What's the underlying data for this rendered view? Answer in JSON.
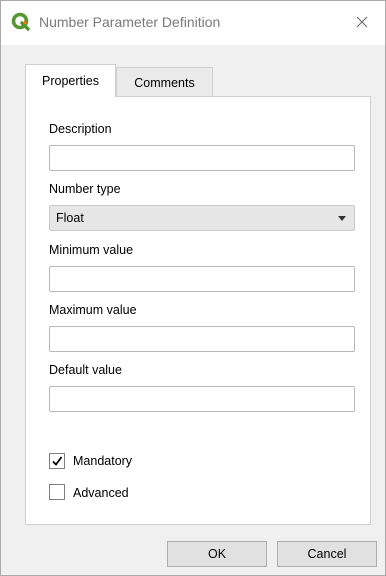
{
  "window": {
    "title": "Number Parameter Definition",
    "app_icon": "qgis-logo-icon",
    "close_icon": "close-icon"
  },
  "tabs": [
    {
      "label": "Properties",
      "active": true
    },
    {
      "label": "Comments",
      "active": false
    }
  ],
  "form": {
    "description_label": "Description",
    "description_value": "",
    "number_type_label": "Number type",
    "number_type_value": "Float",
    "minimum_label": "Minimum value",
    "minimum_value": "",
    "maximum_label": "Maximum value",
    "maximum_value": "",
    "default_label": "Default value",
    "default_value": "",
    "mandatory_label": "Mandatory",
    "mandatory_checked": true,
    "advanced_label": "Advanced",
    "advanced_checked": false
  },
  "buttons": {
    "ok_label": "OK",
    "cancel_label": "Cancel"
  },
  "colors": {
    "qgis_green": "#589632",
    "qgis_yellow": "#ee7913"
  }
}
